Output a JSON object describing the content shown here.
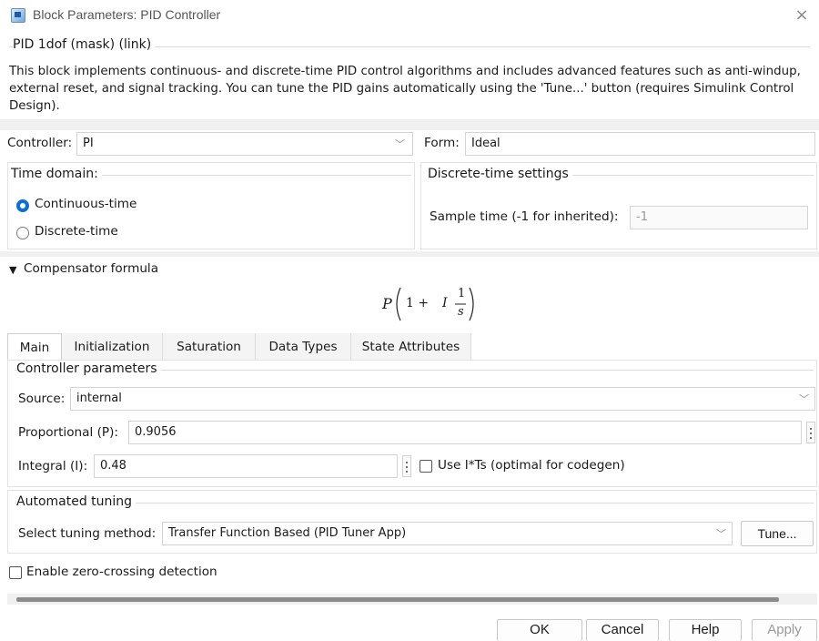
{
  "window": {
    "title": "Block Parameters: PID Controller",
    "close_glyph": "×"
  },
  "mask": {
    "group_title": "PID 1dof (mask) (link)",
    "description": "This block implements continuous- and discrete-time PID control algorithms and includes advanced features such as anti-windup, external reset, and signal tracking. You can tune the PID gains automatically using the 'Tune...' button (requires Simulink Control Design)."
  },
  "controller": {
    "label": "Controller:",
    "value": "PI",
    "form_label": "Form:",
    "form_value": "Ideal"
  },
  "time_domain": {
    "title": "Time domain:",
    "options": [
      "Continuous-time",
      "Discrete-time"
    ],
    "selected": "Continuous-time"
  },
  "discrete_settings": {
    "title": "Discrete-time settings",
    "sample_time_label": "Sample time (-1 for inherited):",
    "sample_time_value": "-1"
  },
  "compensator": {
    "label": "Compensator formula",
    "formula_P": "P",
    "formula_one_plus": "1 +",
    "formula_I": "I",
    "formula_num": "1",
    "formula_den": "s"
  },
  "tabs": [
    "Main",
    "Initialization",
    "Saturation",
    "Data Types",
    "State Attributes"
  ],
  "active_tab": "Main",
  "controller_parameters": {
    "title": "Controller parameters",
    "source_label": "Source:",
    "source_value": "internal",
    "p_label": "Proportional (P):",
    "p_value": "0.9056",
    "i_label": "Integral (I):",
    "i_value": "0.48",
    "use_its_label": "Use I*Ts (optimal for codegen)"
  },
  "automated_tuning": {
    "title": "Automated tuning",
    "method_label": "Select tuning method:",
    "method_value": "Transfer Function Based (PID Tuner App)",
    "tune_button": "Tune..."
  },
  "zero_crossing_label": "Enable zero-crossing detection",
  "buttons": {
    "ok": "OK",
    "cancel": "Cancel",
    "help": "Help",
    "apply": "Apply"
  },
  "colors": {
    "accent": "#0d6fd6",
    "scrollbar": "#8c8c8c"
  }
}
